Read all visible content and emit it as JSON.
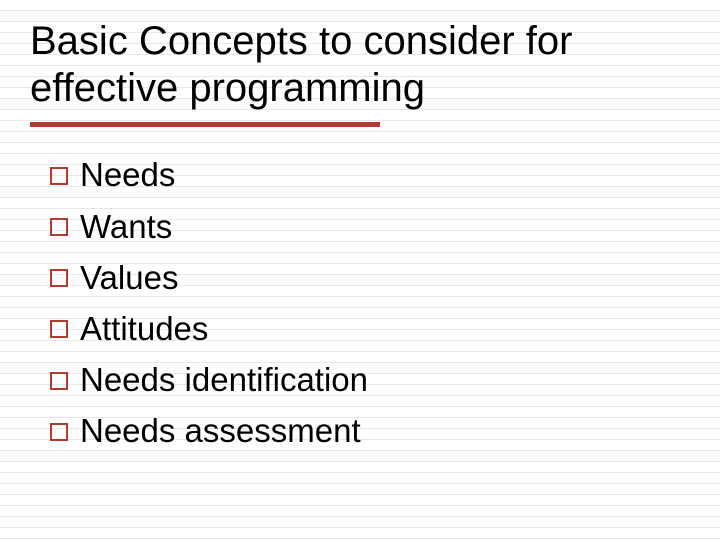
{
  "title": "Basic Concepts to consider for effective programming",
  "bullets": [
    "Needs",
    "Wants",
    "Values",
    "Attitudes",
    "Needs identification",
    "Needs assessment"
  ]
}
